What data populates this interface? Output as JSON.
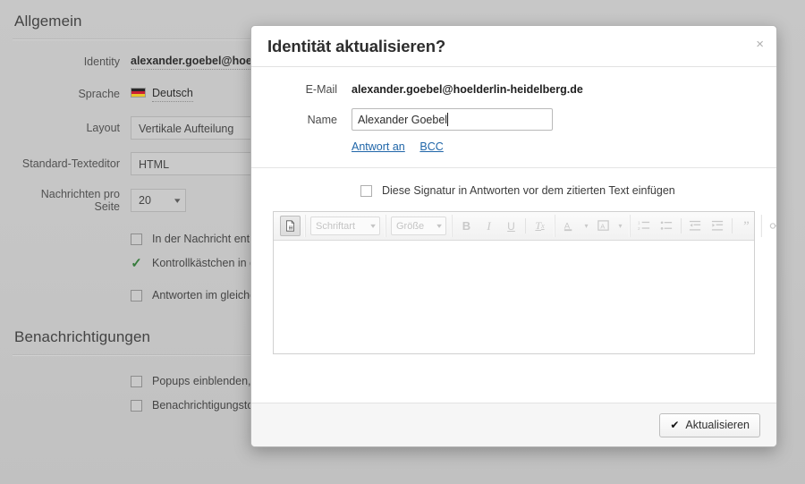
{
  "settings": {
    "sections": [
      {
        "title": "Allgemein",
        "rows": [
          {
            "label": "Identity",
            "value": "alexander.goebel@hoelde",
            "type": "dotted-bold"
          },
          {
            "label": "Sprache",
            "value": "Deutsch",
            "type": "flag-dotted",
            "icon": "german-flag-icon"
          },
          {
            "label": "Layout",
            "value": "Vertikale Aufteilung",
            "type": "input"
          },
          {
            "label": "Standard-Texteditor",
            "value": "HTML",
            "type": "input"
          },
          {
            "label": "Nachrichten pro Seite",
            "value": "20",
            "type": "select"
          }
        ],
        "checks": [
          {
            "label": "In der Nachricht enthalt",
            "checked": false
          },
          {
            "label": "Kontrollkästchen in der",
            "checked": true
          },
          {
            "label": "Antworten im gleichen ",
            "checked": false
          }
        ]
      },
      {
        "title": "Benachrichtigungen",
        "rows": [],
        "checks": [
          {
            "label": "Popups einblenden, we",
            "checked": false
          },
          {
            "label": "Benachrichtigungston",
            "checked": false
          }
        ]
      }
    ]
  },
  "modal": {
    "title": "Identität aktualisieren?",
    "close_label": "×",
    "fields": {
      "email_label": "E-Mail",
      "email_value": "alexander.goebel@hoelderlin-heidelberg.de",
      "name_label": "Name",
      "name_value": "Alexander Goebel",
      "name_placeholder": ""
    },
    "links": [
      {
        "label": "Antwort an"
      },
      {
        "label": "BCC"
      }
    ],
    "signature_checkbox": {
      "label": "Diese Signatur in Antworten vor dem zitierten Text einfügen",
      "checked": false
    },
    "editor": {
      "font_label": "Schriftart",
      "size_label": "Größe",
      "bold_label": "B",
      "italic_label": "I",
      "underline_label": "U",
      "remove_format_label": "Tx",
      "content": ""
    },
    "footer": {
      "submit_label": "Aktualisieren",
      "submit_icon": "check-icon"
    }
  },
  "colors": {
    "page_bg": "#cfcfcf",
    "modal_bg": "#ffffff",
    "link": "#1f65a8",
    "check_green": "#2c7a33",
    "footer_bg": "#f6f6f6"
  }
}
